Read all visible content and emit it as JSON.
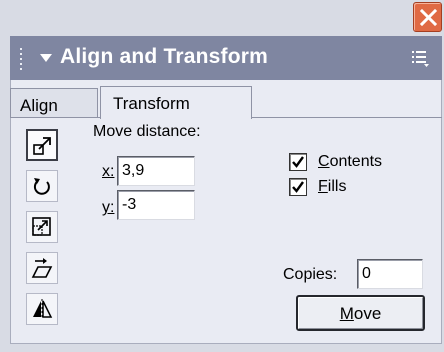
{
  "window": {
    "close_icon": "close-x-icon"
  },
  "panel": {
    "title": "Align and Transform",
    "title_bar_color": "#7f86a1",
    "close_button_color": "#e06a44"
  },
  "tabs": [
    {
      "label": "Align",
      "selected": false
    },
    {
      "label": "Transform",
      "selected": true
    }
  ],
  "tools": [
    {
      "icon": "move-tool-icon",
      "active": true
    },
    {
      "icon": "rotate-tool-icon",
      "active": false
    },
    {
      "icon": "scale-tool-icon",
      "active": false
    },
    {
      "icon": "skew-tool-icon",
      "active": false
    },
    {
      "icon": "mirror-tool-icon",
      "active": false
    }
  ],
  "transform": {
    "heading": "Move distance:",
    "x_label": "x:",
    "x_value": "3,9",
    "y_label": "y:",
    "y_value": "-3",
    "contents_label": "Contents",
    "contents_checked": true,
    "fills_label": "Fills",
    "fills_checked": true,
    "copies_label": "Copies:",
    "copies_value": "0",
    "move_button": "Move"
  }
}
